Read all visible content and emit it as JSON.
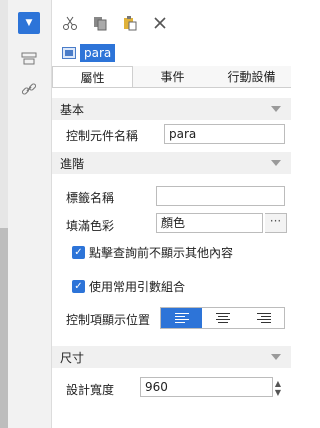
{
  "toolbar": {
    "icons": [
      "cut-icon",
      "copy-icon",
      "paste-icon",
      "delete-icon"
    ]
  },
  "object": {
    "name": "para"
  },
  "tabs": [
    {
      "label": "屬性",
      "active": true
    },
    {
      "label": "事件",
      "active": false
    },
    {
      "label": "行動設備",
      "active": false
    }
  ],
  "sections": {
    "basic": "基本",
    "advanced": "進階",
    "size": "尺寸"
  },
  "fields": {
    "control_name_label": "控制元件名稱",
    "control_name_value": "para",
    "tag_name_label": "標籤名稱",
    "tag_name_value": "",
    "fill_color_label": "填滿色彩",
    "fill_color_value": "顏色",
    "fill_color_button": "···",
    "hide_others_label": "點擊查詢前不顯示其他內容",
    "common_param_label": "使用常用引數組合",
    "control_position_label": "控制項顯示位置",
    "design_width_label": "設計寬度",
    "design_width_value": "960"
  },
  "colors": {
    "accent": "#2d74d8"
  }
}
